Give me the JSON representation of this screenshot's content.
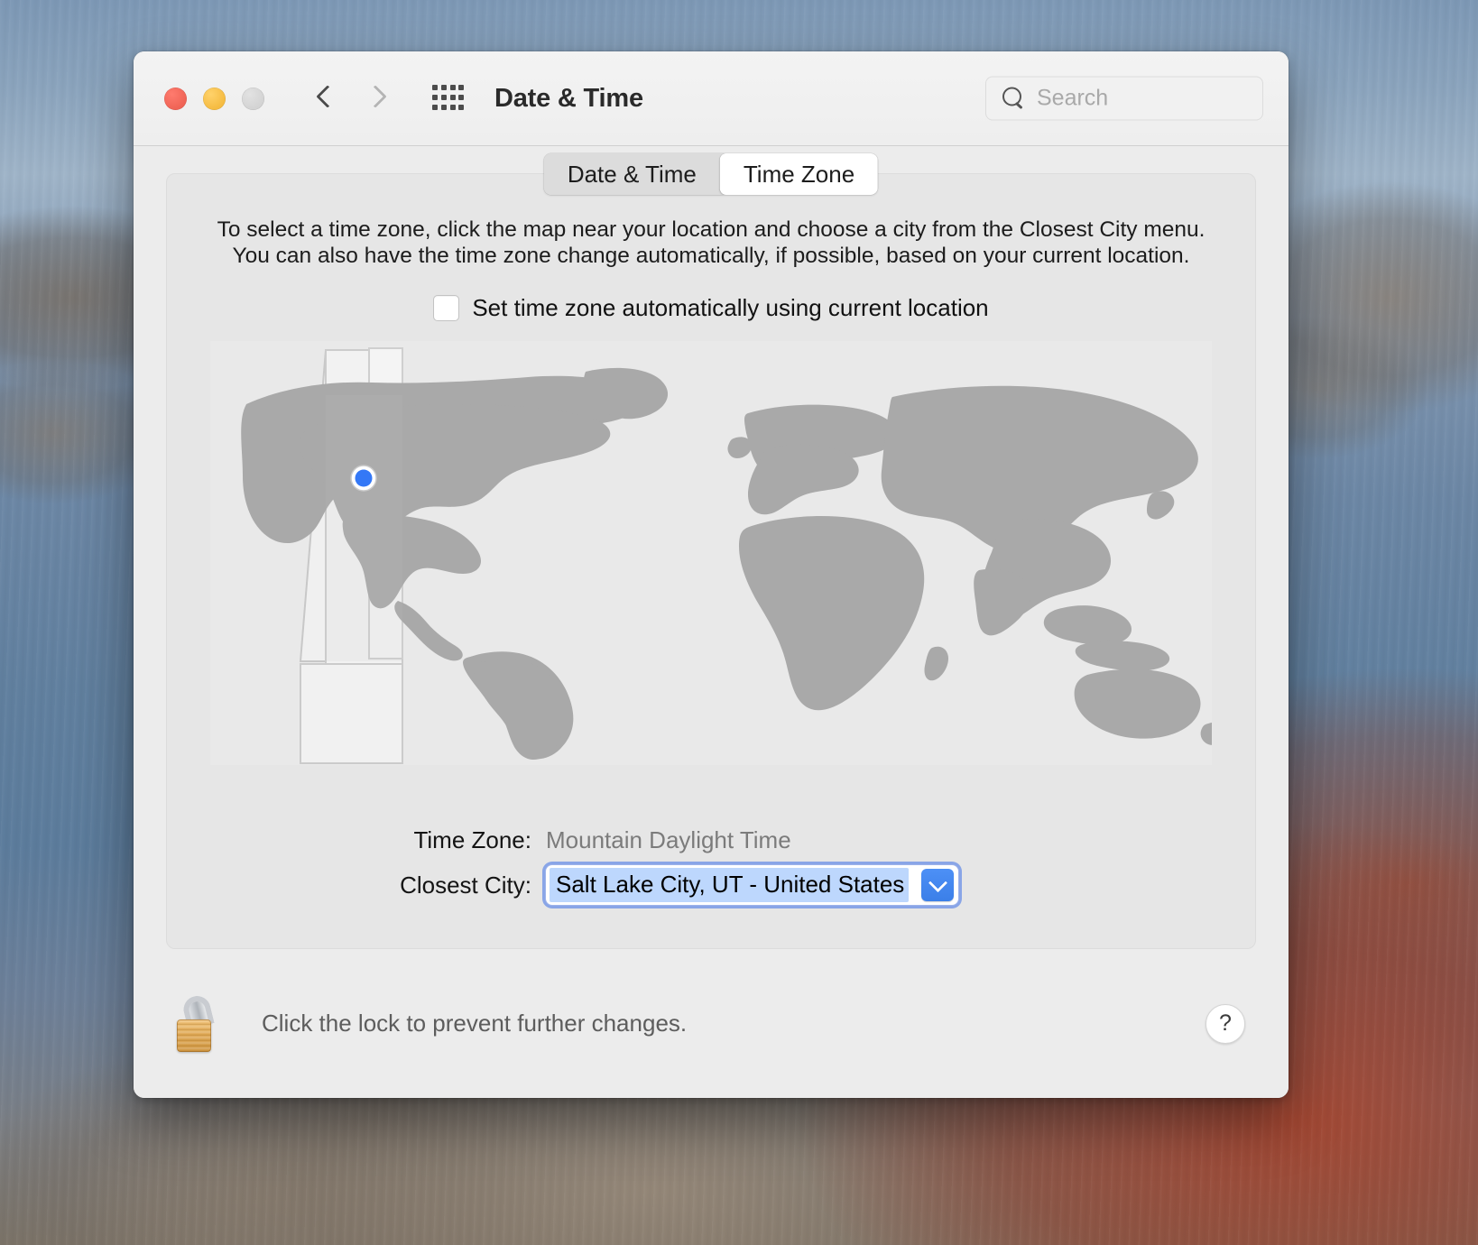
{
  "window": {
    "title": "Date & Time",
    "traffic_lights": [
      "close",
      "minimize",
      "zoom"
    ],
    "nav_back_icon": "chevron-left-icon",
    "nav_forward_icon": "chevron-right-icon",
    "grid_icon": "show-all-grid-icon"
  },
  "search": {
    "placeholder": "Search",
    "value": "",
    "icon": "search-icon"
  },
  "tabs": [
    {
      "label": "Date & Time",
      "active": false
    },
    {
      "label": "Time Zone",
      "active": true
    }
  ],
  "instructions": {
    "line1": "To select a time zone, click the map near your location and choose a city from the Closest City menu.",
    "line2": "You can also have the time zone change automatically, if possible, based on your current location."
  },
  "auto_timezone": {
    "label": "Set time zone automatically using current location",
    "checked": false
  },
  "map": {
    "marker_label": "current-location-marker",
    "marker_color": "#3478f6",
    "land_color": "#aaaaaa",
    "ocean_color": "#e9e9e9",
    "highlight_band_color": "#cfcfcf"
  },
  "fields": [
    {
      "label": "Time Zone:",
      "value": "Mountain Daylight Time"
    },
    {
      "label": "Closest City:",
      "value": "Salt Lake City, UT - United States"
    }
  ],
  "footer": {
    "lock_icon": "unlocked-padlock-icon",
    "lock_caption": "Click the lock to prevent further changes.",
    "help_label": "?"
  },
  "colors": {
    "accent": "#3478f6",
    "selection": "#bdd7fd",
    "focus_ring": "#7899e6",
    "window_bg": "#ececec",
    "pane_bg": "#e6e6e6",
    "titlebar_bg": "#f1f1f1"
  }
}
